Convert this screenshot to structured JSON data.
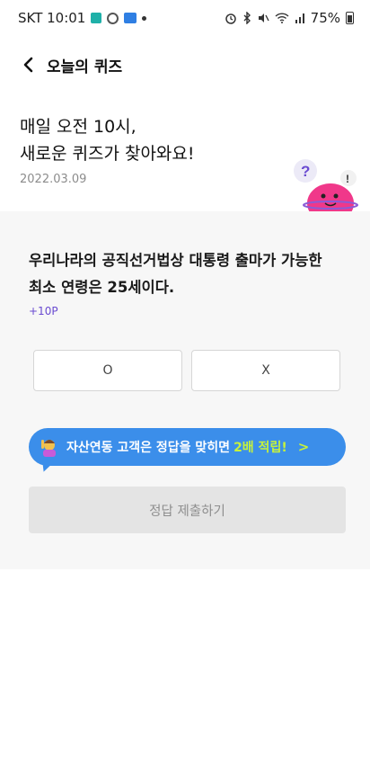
{
  "status_bar": {
    "carrier_time": "SKT 10:01",
    "battery": "75%"
  },
  "header": {
    "title": "오늘의 퀴즈"
  },
  "intro": {
    "line1": "매일 오전 10시,",
    "line2": "새로운 퀴즈가 찾아와요!",
    "date": "2022.03.09"
  },
  "quiz": {
    "question_line1": "우리나라의 공직선거법상 대통령 출마가 가능한",
    "question_line2_prefix": "최소 연령은 ",
    "question_line2_number": "25",
    "question_line2_suffix": "세이다.",
    "points": "+10P",
    "choices": [
      {
        "label": "O"
      },
      {
        "label": "X"
      }
    ],
    "promo_text": "자산연동 고객은 정답을 맞히면",
    "promo_highlight": "2배 적립!",
    "promo_arrow": ">",
    "submit_label": "정답 제출하기"
  },
  "colors": {
    "accent_blue": "#3b8eea",
    "highlight_green": "#c6f23b",
    "points_purple": "#6a4bd1"
  }
}
